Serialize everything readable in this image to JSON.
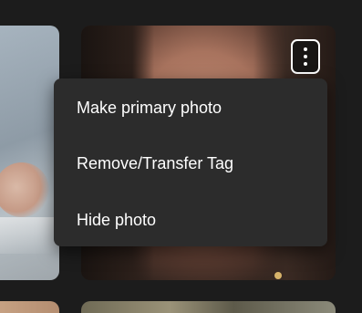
{
  "photo_grid": {
    "tiles": [
      {
        "name": "photo-tile-left",
        "subject": "hand-photo"
      },
      {
        "name": "photo-tile-right",
        "subject": "face-photo"
      }
    ]
  },
  "more_button": {
    "icon": "more-vertical-icon"
  },
  "context_menu": {
    "items": [
      {
        "label": "Make primary photo"
      },
      {
        "label": "Remove/Transfer Tag"
      },
      {
        "label": "Hide photo"
      }
    ]
  }
}
